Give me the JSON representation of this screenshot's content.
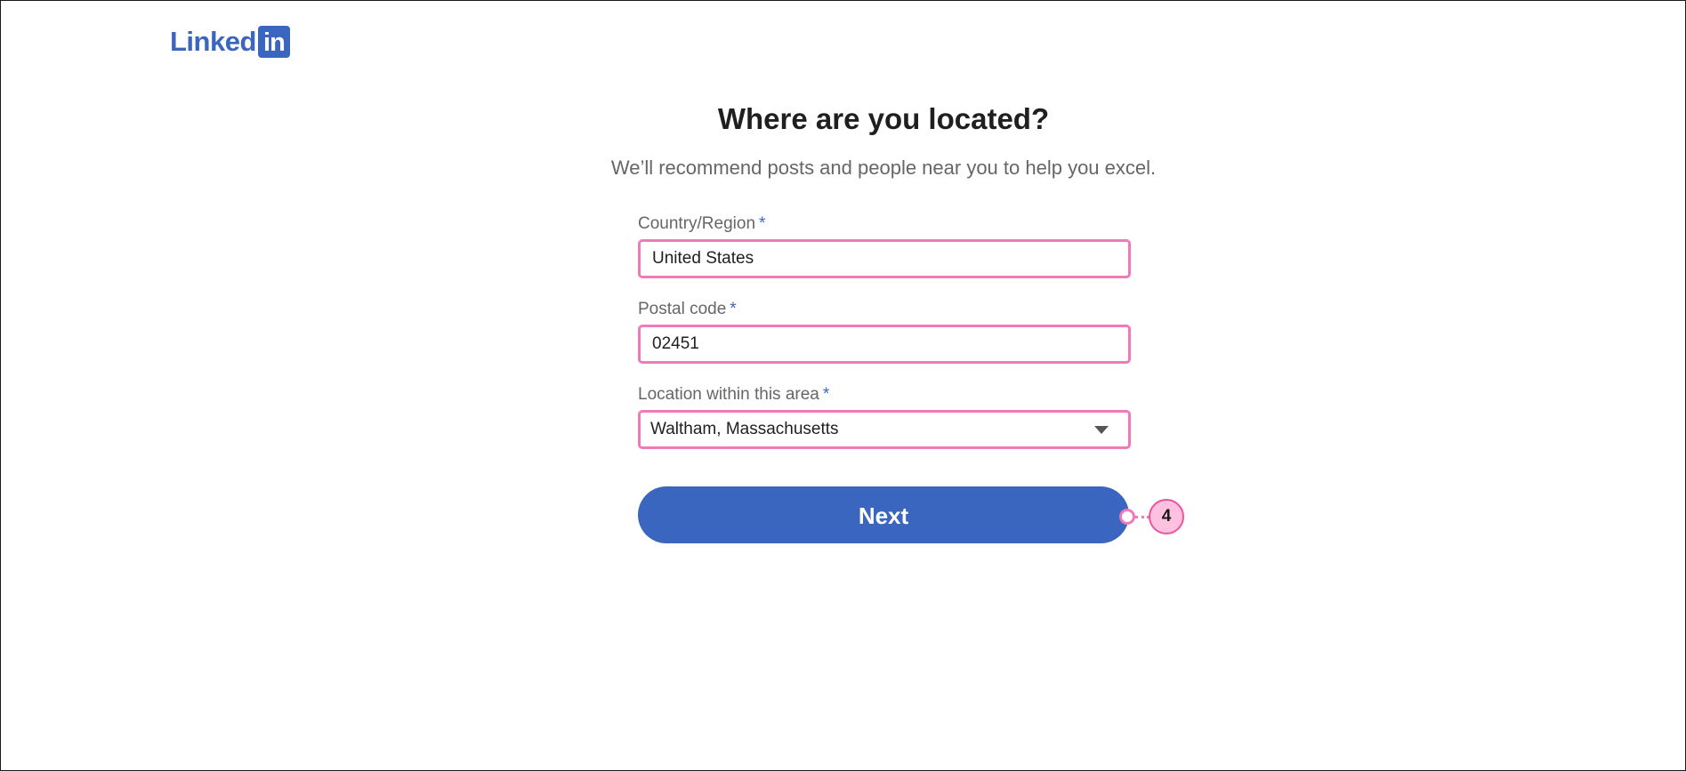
{
  "brand": {
    "logo_word": "Linked",
    "logo_in": "in",
    "color": "#3b66bf"
  },
  "page": {
    "title": "Where are you located?",
    "subtitle": "We’ll recommend posts and people near you to help you excel."
  },
  "form": {
    "country": {
      "label": "Country/Region",
      "required_mark": "*",
      "value": "United States"
    },
    "postal": {
      "label": "Postal code",
      "required_mark": "*",
      "value": "02451"
    },
    "location": {
      "label": "Location within this area",
      "required_mark": "*",
      "value": "Waltham, Massachusetts",
      "icon": "chevron-down-icon"
    },
    "next_label": "Next"
  },
  "annotation": {
    "marker_number": "4",
    "highlight_color": "#f07ab8"
  }
}
